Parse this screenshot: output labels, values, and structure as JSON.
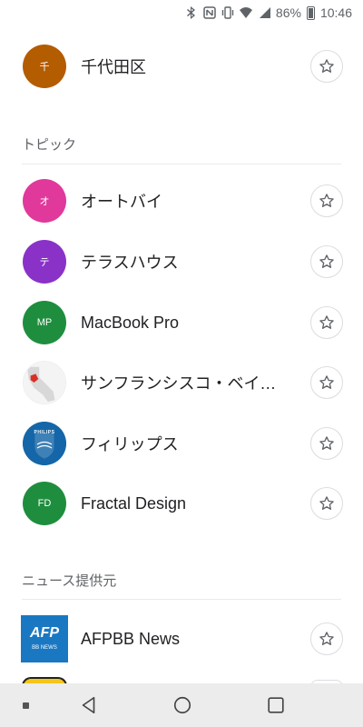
{
  "status_bar": {
    "battery_percent": "86%",
    "time": "10:46",
    "icons": [
      "bluetooth-icon",
      "nfc-icon",
      "vibrate-icon",
      "wifi-icon",
      "signal-icon",
      "battery-icon"
    ]
  },
  "top_items": [
    {
      "name": "千代田区",
      "avatar_text": "千",
      "color": "#b35c00"
    }
  ],
  "topics": {
    "header": "トピック",
    "items": [
      {
        "name": "オートバイ",
        "avatar_text": "オ",
        "color": "#e0399b"
      },
      {
        "name": "テラスハウス",
        "avatar_text": "テ",
        "color": "#8a32c8"
      },
      {
        "name": "MacBook Pro",
        "avatar_text": "MP",
        "color": "#1e8e3e"
      },
      {
        "name": "サンフランシスコ・ベイエリア",
        "avatar_text": "",
        "color": "#ffffff"
      },
      {
        "name": "フィリップス",
        "avatar_text": "PHILIPS",
        "color": "#1466a8"
      },
      {
        "name": "Fractal Design",
        "avatar_text": "FD",
        "color": "#1e8e3e"
      }
    ]
  },
  "sources": {
    "header": "ニュース提供元",
    "items": [
      {
        "name": "AFPBB News",
        "logo_text": "AFP",
        "logo_sub": "BB NEWS",
        "color": "#1a78c2"
      }
    ]
  },
  "nav": {
    "icons": [
      "menu-dot-icon",
      "back-icon",
      "home-icon",
      "recents-icon"
    ]
  }
}
